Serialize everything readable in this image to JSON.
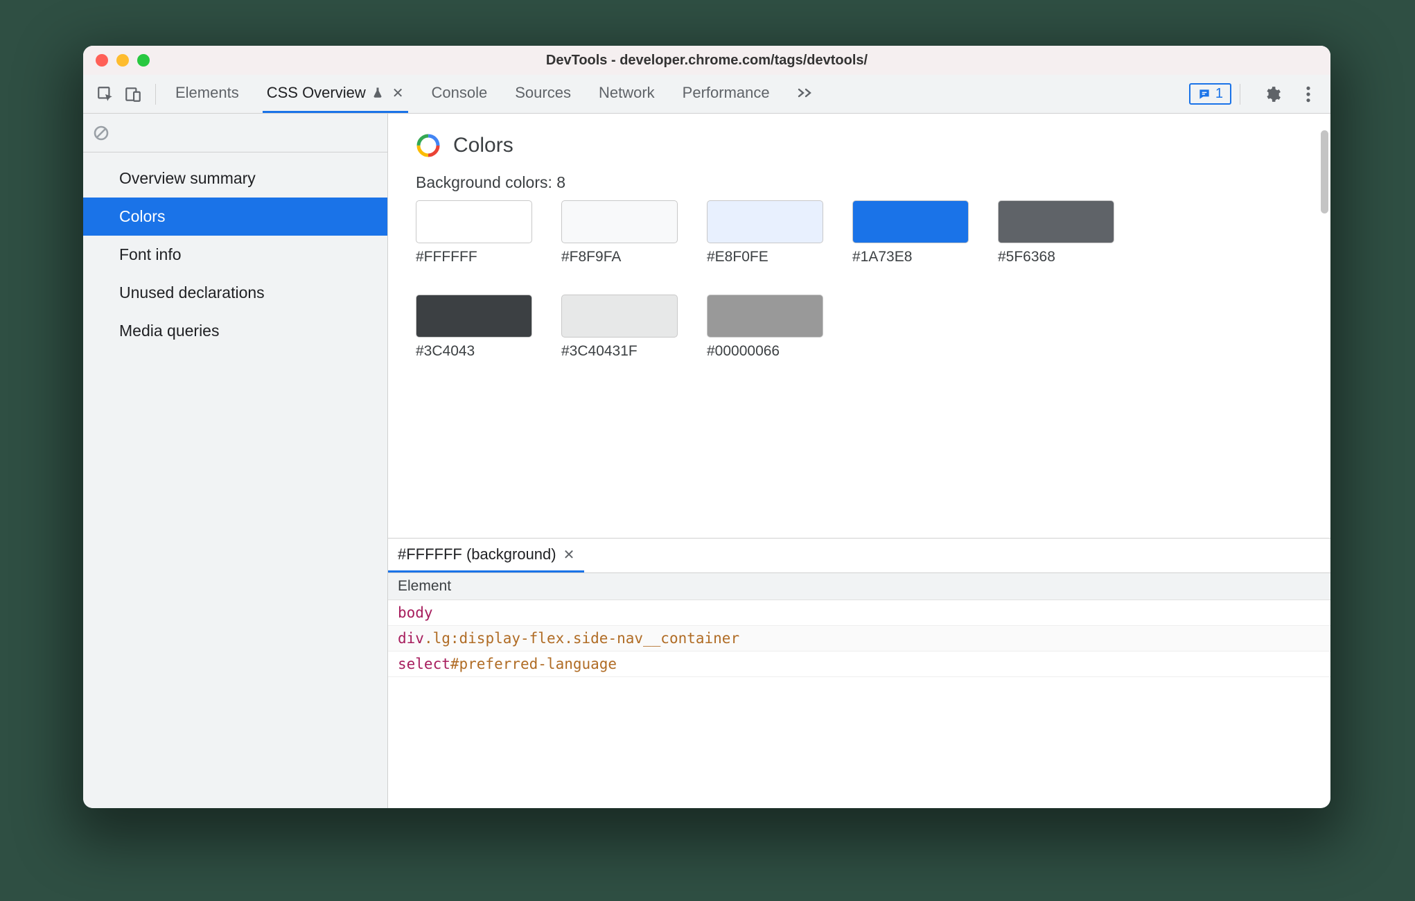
{
  "window": {
    "title": "DevTools - developer.chrome.com/tags/devtools/"
  },
  "toolbar": {
    "tabs": {
      "elements": "Elements",
      "css_overview": "CSS Overview",
      "console": "Console",
      "sources": "Sources",
      "network": "Network",
      "performance": "Performance"
    },
    "feedback_count": "1"
  },
  "sidebar": {
    "items": [
      {
        "label": "Overview summary"
      },
      {
        "label": "Colors"
      },
      {
        "label": "Font info"
      },
      {
        "label": "Unused declarations"
      },
      {
        "label": "Media queries"
      }
    ],
    "selected_index": 1
  },
  "colors_section": {
    "title": "Colors",
    "bg_heading": "Background colors: 8",
    "swatches": [
      {
        "hex": "#FFFFFF",
        "css": "#FFFFFF"
      },
      {
        "hex": "#F8F9FA",
        "css": "#F8F9FA"
      },
      {
        "hex": "#E8F0FE",
        "css": "#E8F0FE"
      },
      {
        "hex": "#1A73E8",
        "css": "#1A73E8"
      },
      {
        "hex": "#5F6368",
        "css": "#5F6368"
      },
      {
        "hex": "#3C4043",
        "css": "#3C4043"
      },
      {
        "hex": "#3C40431F",
        "css": "rgba(60,64,67,0.12)"
      },
      {
        "hex": "#00000066",
        "css": "rgba(0,0,0,0.40)"
      }
    ]
  },
  "details": {
    "tab_label": "#FFFFFF (background)",
    "column_header": "Element",
    "rows": [
      [
        {
          "t": "tag",
          "v": "body"
        }
      ],
      [
        {
          "t": "tag",
          "v": "div"
        },
        {
          "t": "cls",
          "v": ".lg:display-flex"
        },
        {
          "t": "cls",
          "v": ".side-nav__container"
        }
      ],
      [
        {
          "t": "tag",
          "v": "select"
        },
        {
          "t": "id",
          "v": "#preferred-language"
        }
      ]
    ]
  }
}
